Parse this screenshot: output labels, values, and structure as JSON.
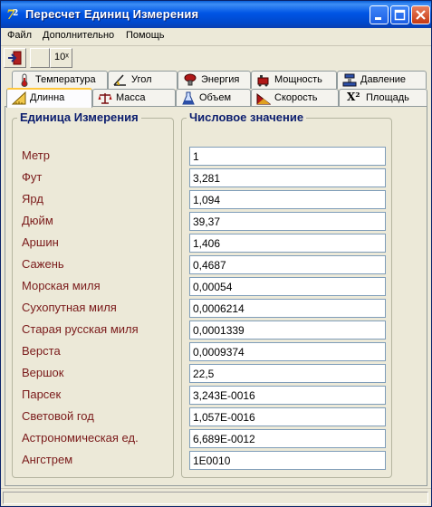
{
  "window": {
    "title": "Пересчет Единиц Измерения"
  },
  "menu": [
    "Файл",
    "Дополнительно",
    "Помощь"
  ],
  "toolbar": {
    "power_label": "10ˣ"
  },
  "tabs_row1": [
    {
      "label": "Температура",
      "icon": "thermometer-icon"
    },
    {
      "label": "Угол",
      "icon": "angle-icon"
    },
    {
      "label": "Энергия",
      "icon": "energy-icon"
    },
    {
      "label": "Мощность",
      "icon": "power-icon"
    },
    {
      "label": "Давление",
      "icon": "pressure-icon"
    }
  ],
  "tabs_row2": [
    {
      "label": "Длинна",
      "icon": "ruler-icon",
      "active": true
    },
    {
      "label": "Масса",
      "icon": "scales-icon"
    },
    {
      "label": "Объем",
      "icon": "flask-icon"
    },
    {
      "label": "Скорость",
      "icon": "speed-icon"
    },
    {
      "label": "Площадь",
      "icon": "area-icon",
      "icon_text": "X²"
    }
  ],
  "groups": {
    "units_title": "Единица Измерения",
    "values_title": "Числовое значение"
  },
  "rows": [
    {
      "unit": "Метр",
      "value": "1"
    },
    {
      "unit": "Фут",
      "value": "3,281"
    },
    {
      "unit": "Ярд",
      "value": "1,094"
    },
    {
      "unit": "Дюйм",
      "value": "39,37"
    },
    {
      "unit": "Аршин",
      "value": "1,406"
    },
    {
      "unit": "Сажень",
      "value": "0,4687"
    },
    {
      "unit": "Морская миля",
      "value": "0,00054"
    },
    {
      "unit": "Сухопутная миля",
      "value": "0,0006214"
    },
    {
      "unit": "Старая русская миля",
      "value": "0,0001339"
    },
    {
      "unit": "Верста",
      "value": "0,0009374"
    },
    {
      "unit": "Вершок",
      "value": "22,5"
    },
    {
      "unit": "Парсек",
      "value": "3,243E-0016"
    },
    {
      "unit": "Световой год",
      "value": "1,057E-0016"
    },
    {
      "unit": "Астрономическая ед.",
      "value": "6,689E-0012"
    },
    {
      "unit": "Ангстрем",
      "value": "1E0010"
    }
  ]
}
